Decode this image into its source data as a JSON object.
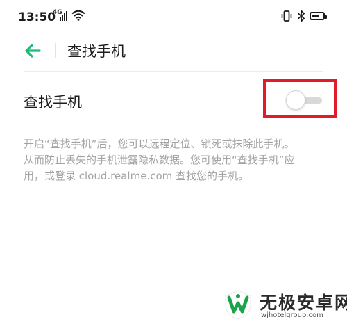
{
  "status_bar": {
    "time": "13:50",
    "network": "4G",
    "battery_level": 0.7
  },
  "header": {
    "back_icon": "arrow-left-icon",
    "title": "查找手机"
  },
  "setting": {
    "label": "查找手机",
    "toggle_on": false
  },
  "description": {
    "lines": [
      "开启“查找手机”后，您可以远程定位、锁死或抹除此手机。",
      "从而防止丢失的手机泄露隐私数据。您可使用“查找手机”应",
      "用，或登录 cloud.realme.com 查找您的手机。"
    ]
  },
  "watermark": {
    "name": "无极安卓网",
    "url": "wjhotelgroup.com"
  },
  "colors": {
    "accent": "#1db97b",
    "highlight": "#e11b2a",
    "secondary_text": "#a3a3a3"
  }
}
